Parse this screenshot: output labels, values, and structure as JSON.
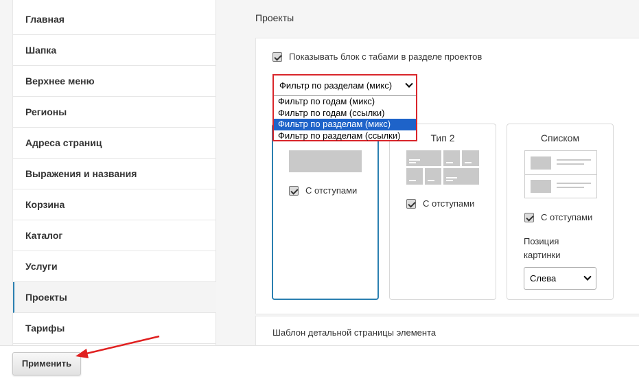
{
  "sidebar": {
    "items": [
      {
        "label": "Главная"
      },
      {
        "label": "Шапка"
      },
      {
        "label": "Верхнее меню"
      },
      {
        "label": "Регионы"
      },
      {
        "label": "Адреса страниц"
      },
      {
        "label": "Выражения и названия"
      },
      {
        "label": "Корзина"
      },
      {
        "label": "Каталог"
      },
      {
        "label": "Услуги"
      },
      {
        "label": "Проекты",
        "active": true
      },
      {
        "label": "Тарифы"
      }
    ]
  },
  "main": {
    "section_title": "Проекты",
    "show_tabs_label": "Показывать блок с табами в разделе проектов",
    "show_tabs_checked": true,
    "filter_select": {
      "value": "Фильтр по разделам (микс)",
      "options": [
        "Фильтр по годам (микс)",
        "Фильтр по годам (ссылки)",
        "Фильтр по разделам (микс)",
        "Фильтр по разделам (ссылки)"
      ],
      "selected_index": 2
    },
    "cards": [
      {
        "title": "",
        "padding_label": "С отступами",
        "checked": true,
        "active": true
      },
      {
        "title": "Тип 2",
        "padding_label": "С отступами",
        "checked": true,
        "active": false
      },
      {
        "title": "Списком",
        "padding_label": "С отступами",
        "checked": true,
        "active": false
      }
    ],
    "image_position": {
      "label": "Позиция картинки",
      "value": "Слева"
    },
    "detail_template_label": "Шаблон детальной страницы элемента"
  },
  "footer": {
    "apply_label": "Применить"
  },
  "colors": {
    "highlight": "#d9252a",
    "accent": "#2a7fb0",
    "option_selected": "#1e63c9"
  }
}
